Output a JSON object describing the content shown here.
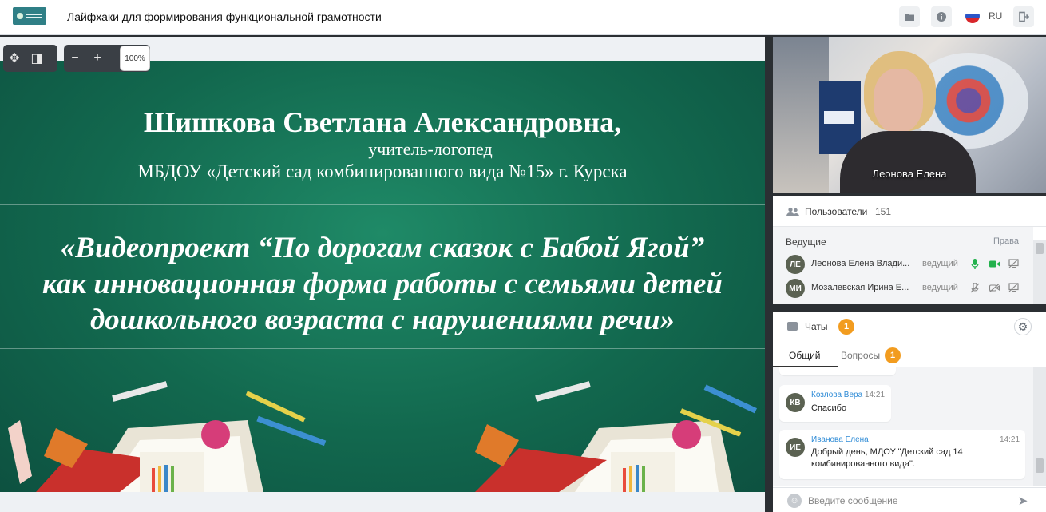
{
  "header": {
    "title": "Лайфхаки для формирования функциональной грамотности",
    "language": "RU",
    "icons": [
      "folder-icon",
      "info-icon",
      "flag-ru-icon",
      "exit-icon"
    ]
  },
  "presentation": {
    "zoom_label": "100%",
    "slide": {
      "name": "Шишкова Светлана Александровна,",
      "role": "учитель-логопед",
      "org": "МБДОУ «Детский сад комбинированного вида №15» г. Курска",
      "topic_line1": "«Видеопроект “По дорогам сказок с Бабой Ягой”",
      "topic_line2": "как инновационная форма работы с семьями детей",
      "topic_line3": "дошкольного возраста с нарушениями речи»"
    }
  },
  "video": {
    "speaker_name": "Леонова Елена"
  },
  "users": {
    "title": "Пользователи",
    "count": "151",
    "section_label": "Ведущие",
    "rights_label": "Права",
    "list": [
      {
        "initials": "ЛЕ",
        "name": "Леонова Елена Влади...",
        "role": "ведущий"
      },
      {
        "initials": "МИ",
        "name": "Мозалевская Ирина Е...",
        "role": "ведущий"
      }
    ]
  },
  "chat": {
    "title": "Чаты",
    "unread": "1",
    "tabs": [
      {
        "label": "Общий"
      },
      {
        "label": "Вопросы",
        "badge": "1"
      }
    ],
    "messages": [
      {
        "initials": "КВ",
        "author": "Козлова Вера",
        "time": "14:21",
        "text": "Спасибо"
      },
      {
        "initials": "ИЕ",
        "author": "Иванова Елена",
        "time": "14:21",
        "text_line1": "Добрый день, МДОУ \"Детский сад 14",
        "text_line2": "комбинированного вида\"."
      }
    ],
    "input_placeholder": "Введите сообщение"
  },
  "colors": {
    "slide_green": "#12684e",
    "badge_orange": "#f29c1f",
    "author_blue": "#2e8bd6",
    "mic_green": "#22b14c"
  }
}
